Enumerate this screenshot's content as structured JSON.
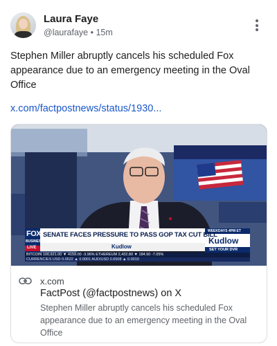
{
  "author": {
    "name": "Laura Faye",
    "handle": "@laurafaye",
    "separator": "•",
    "time": "15m"
  },
  "post": {
    "text": "Stephen Miller abruptly cancels his scheduled Fox appearance due to an emergency meeting in the Oval Office",
    "link_text": "x.com/factpostnews/status/1930..."
  },
  "card": {
    "domain": "x.com",
    "title": "FactPost (@factpostnews) on X",
    "description": "Stephen Miller abruptly cancels his scheduled Fox appearance due to an emergency meeting in the Oval Office",
    "image": {
      "network_logo": "FOX",
      "network_sub": "BUSINESS",
      "live_label": "LIVE",
      "headline": "SENATE FACES PRESSURE TO PASS GOP TAX CUT BILL",
      "show_name": "Kudlow",
      "schedule": "WEEKDAYS 4PM ET",
      "dvr": "SET YOUR DVR",
      "ticker_row1": "BITCOIN  100,921.00 ▼ 4159.00 -3.96%  ETHEREUM  2,432.80 ▼ 184.50 -7.05%",
      "ticker_row2": "CURRENCIES  USD 0.0522 ▲ 0.0001  AUD/USD 0.6508 ▲ 0.0019"
    }
  },
  "colors": {
    "link": "#1a57c9",
    "fox_blue": "#0a2a6b",
    "fox_red": "#c8102e"
  },
  "icons": {
    "more": "more-vertical-icon",
    "card_link": "link-icon"
  }
}
